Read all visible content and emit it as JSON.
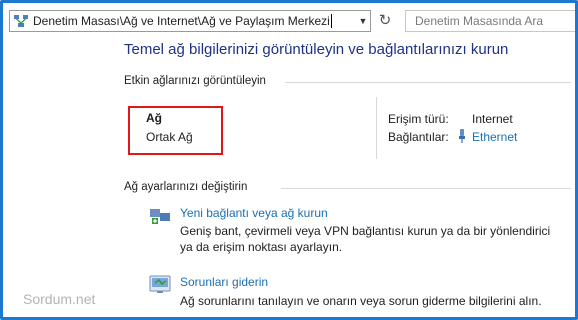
{
  "address_bar": {
    "path": "Denetim Masası\\Ağ ve Internet\\Ağ ve Paylaşım Merkezi"
  },
  "search": {
    "placeholder": "Denetim Masasında Ara"
  },
  "page_title": "Temel ağ bilgilerinizi görüntüleyin ve bağlantılarınızı kurun",
  "active_networks": {
    "heading": "Etkin ağlarınızı görüntüleyin",
    "network_name": "Ağ",
    "network_profile": "Ortak Ağ",
    "access_type_label": "Erişim türü:",
    "access_type_value": "Internet",
    "connections_label": "Bağlantılar:",
    "connections_value": "Ethernet"
  },
  "settings": {
    "heading": "Ağ ayarlarınızı değiştirin",
    "tasks": [
      {
        "title": "Yeni bağlantı veya ağ kurun",
        "description": "Geniş bant, çevirmeli veya VPN bağlantısı kurun ya da bir yönlendirici ya da erişim noktası ayarlayın."
      },
      {
        "title": "Sorunları giderin",
        "description": "Ağ sorunlarını tanılayın ve onarın veya sorun giderme bilgilerini alın."
      }
    ]
  },
  "watermark": "Sordum.net",
  "colors": {
    "frame_border": "#1e78d2",
    "title_blue": "#1e3287",
    "link_blue": "#1a6fb5",
    "highlight_red": "#e0161b"
  }
}
